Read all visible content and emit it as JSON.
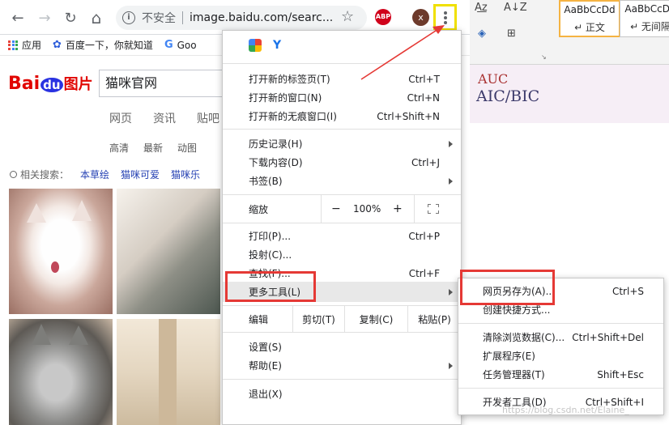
{
  "browser": {
    "nav": {
      "back": "←",
      "forward": "→",
      "reload": "↻",
      "home": "⌂"
    },
    "omnibox": {
      "info_glyph": "i",
      "insecure_label": "不安全",
      "url": "image.baidu.com/searc..."
    },
    "star_glyph": "☆",
    "abp_label": "ABP",
    "avatar_letter": "x",
    "bookmarks": [
      {
        "label": "应用",
        "icon": "apps-grid-icon"
      },
      {
        "label": "百度一下，你就知道",
        "icon": "baidu-paw-icon"
      },
      {
        "label": "Goo",
        "icon": "google-g-icon"
      }
    ]
  },
  "baidu": {
    "logo": {
      "bai": "Bai",
      "du": "du",
      "tu": "图片"
    },
    "query": "猫咪官网",
    "tabs": [
      "网页",
      "资讯",
      "贴吧"
    ],
    "filters": [
      "高清",
      "最新",
      "动图"
    ],
    "related_label": "相关搜索：",
    "related": [
      "本草绘",
      "猫咪可爱",
      "猫咪乐"
    ]
  },
  "word": {
    "styles": [
      {
        "sample": "AaBbCcDd",
        "name": "↵ 正文"
      },
      {
        "sample": "AaBbCcDd",
        "name": "↵ 无间隔"
      }
    ],
    "doc_line1": "AUC",
    "doc_line2": "AIC/BIC"
  },
  "menu": {
    "items": [
      {
        "label": "打开新的标签页(T)",
        "shortcut": "Ctrl+T"
      },
      {
        "label": "打开新的窗口(N)",
        "shortcut": "Ctrl+N"
      },
      {
        "label": "打开新的无痕窗口(I)",
        "shortcut": "Ctrl+Shift+N"
      },
      {
        "label": "历史记录(H)",
        "shortcut": ""
      },
      {
        "label": "下载内容(D)",
        "shortcut": "Ctrl+J"
      },
      {
        "label": "书签(B)",
        "shortcut": ""
      },
      {
        "label": "打印(P)...",
        "shortcut": "Ctrl+P"
      },
      {
        "label": "投射(C)...",
        "shortcut": ""
      },
      {
        "label": "查找(F)...",
        "shortcut": "Ctrl+F"
      },
      {
        "label": "更多工具(L)",
        "shortcut": ""
      },
      {
        "label": "设置(S)",
        "shortcut": ""
      },
      {
        "label": "帮助(E)",
        "shortcut": ""
      },
      {
        "label": "退出(X)",
        "shortcut": ""
      }
    ],
    "zoom": {
      "label": "缩放",
      "minus": "−",
      "value": "100%",
      "plus": "+"
    },
    "edit": {
      "label": "编辑",
      "cut": "剪切(T)",
      "copy": "复制(C)",
      "paste": "粘贴(P)"
    }
  },
  "submenu": {
    "items": [
      {
        "label": "网页另存为(A)...",
        "shortcut": "Ctrl+S"
      },
      {
        "label": "创建快捷方式...",
        "shortcut": ""
      },
      {
        "label": "清除浏览数据(C)...",
        "shortcut": "Ctrl+Shift+Del"
      },
      {
        "label": "扩展程序(E)",
        "shortcut": ""
      },
      {
        "label": "任务管理器(T)",
        "shortcut": "Shift+Esc"
      },
      {
        "label": "开发者工具(D)",
        "shortcut": "Ctrl+Shift+I"
      }
    ]
  },
  "watermark": "https://blog.csdn.net/Elaine_"
}
